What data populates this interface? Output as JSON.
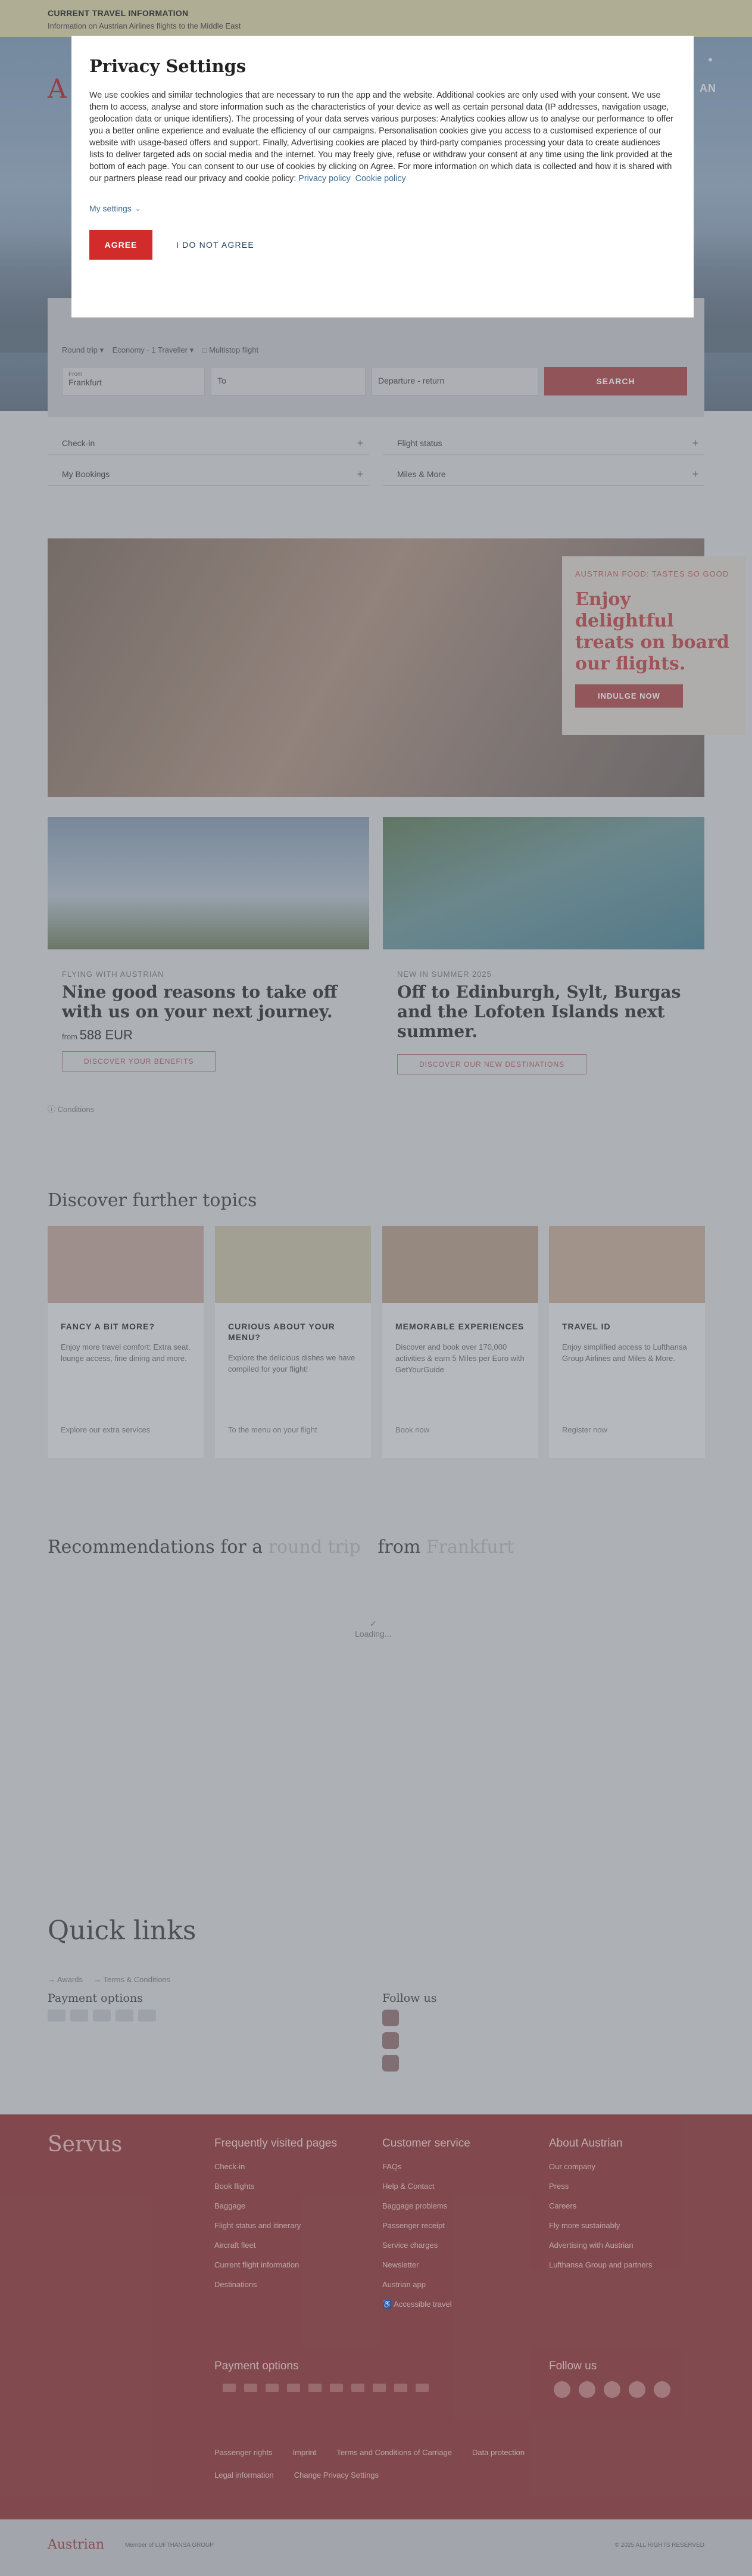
{
  "infobar": {
    "title": "CURRENT TRAVEL INFORMATION",
    "subtitle": "Information on Austrian Airlines flights to the Middle East"
  },
  "header": {
    "logo": "A",
    "nav_right": "AN"
  },
  "booking": {
    "trip": "Round trip",
    "cabin": "Economy · 1 Traveller",
    "flex": "Multistop flight",
    "from_label": "From",
    "from_value": "Frankfurt",
    "to": "To",
    "dates": "Departure - return",
    "search": "SEARCH"
  },
  "quicklinks_top": [
    {
      "label": "Check-in"
    },
    {
      "label": "Flight status"
    },
    {
      "label": "My Bookings"
    },
    {
      "label": "Miles & More"
    }
  ],
  "promo": {
    "kicker": "AUSTRIAN FOOD: TASTES SO GOOD",
    "title": "Enjoy delightful treats on board our flights.",
    "button": "INDULGE NOW"
  },
  "cards": [
    {
      "kicker": "FLYING WITH AUSTRIAN",
      "title": "Nine good reasons to take off with us on your next journey.",
      "price_from": "from",
      "price": "588 EUR",
      "button": "DISCOVER YOUR BENEFITS"
    },
    {
      "kicker": "NEW IN SUMMER 2025",
      "title": "Off to Edinburgh, Sylt, Burgas and the Lofoten Islands next summer.",
      "button": "DISCOVER OUR NEW DESTINATIONS"
    }
  ],
  "conditions": "Conditions",
  "topics": {
    "heading": "Discover further topics",
    "items": [
      {
        "title": "FANCY A BIT MORE?",
        "desc": "Enjoy more travel comfort: Extra seat, lounge access, fine dining and more.",
        "link": "Explore our extra services"
      },
      {
        "title": "CURIOUS ABOUT YOUR MENU?",
        "desc": "Explore the delicious dishes we have compiled for your flight!",
        "link": "To the menu on your flight"
      },
      {
        "title": "MEMORABLE EXPERIENCES",
        "desc": "Discover and book over 170,000 activities & earn 5 Miles per Euro with GetYourGuide",
        "link": "Book now"
      },
      {
        "title": "TRAVEL ID",
        "desc": "Enjoy simplified access to Lufthansa Group Airlines and Miles & More.",
        "link": "Register now"
      }
    ]
  },
  "reco": {
    "prefix": "Recommendations for a",
    "trip": "round trip",
    "from": "from",
    "city": "Frankfurt",
    "loading": "Loading..."
  },
  "quicklinks": {
    "heading": "Quick links",
    "links": [
      "Awards",
      "Terms & Conditions"
    ],
    "payment": "Payment options",
    "follow": "Follow us"
  },
  "footer": {
    "servus": "Servus",
    "col1": {
      "title": "Frequently visited pages",
      "items": [
        "Check-in",
        "Book flights",
        "Baggage",
        "Flight status and itinerary",
        "Aircraft fleet",
        "Current flight information",
        "Destinations"
      ]
    },
    "col2": {
      "title": "Customer service",
      "items": [
        "FAQs",
        "Help & Contact",
        "Baggage problems",
        "Passenger receipt",
        "Service charges",
        "Newsletter",
        "Austrian app",
        "Accessible travel"
      ]
    },
    "col3": {
      "title": "About Austrian",
      "items": [
        "Our company",
        "Press",
        "Careers",
        "Fly more sustainably",
        "Advertising with Austrian",
        "Lufthansa Group and partners"
      ]
    },
    "payment": "Payment options",
    "follow": "Follow us",
    "legal1": [
      "Passenger rights",
      "Imprint",
      "Terms and Conditions of Carriage",
      "Data protection"
    ],
    "legal2": [
      "Legal information",
      "Change Privacy Settings"
    ]
  },
  "bottom": {
    "logo": "Austrian",
    "member": "Member of LUFTHANSA GROUP",
    "copyright": "© 2025 ALL RIGHTS RESERVED"
  },
  "modal": {
    "title": "Privacy Settings",
    "body": "We use cookies and similar technologies that are necessary to run the app and the website. Additional cookies are only used with your consent. We use them to access, analyse and store information such as the characteristics of your device as well as certain personal data (IP addresses, navigation usage, geolocation data or unique identifiers). The processing of your data serves various purposes: Analytics cookies allow us to analyse our performance to offer you a better online experience and evaluate the efficiency of our campaigns. Personalisation cookies give you access to a customised experience of our website with usage-based offers and support. Finally, Advertising cookies are placed by third-party companies processing your data to create audiences lists to deliver targeted ads on social media and the internet. You may freely give, refuse or withdraw your consent at any time using the link provided at the bottom of each page. You can consent to our use of cookies by clicking on Agree. For more information on which data is collected and how it is shared with our partners please read our privacy and cookie policy:",
    "privacy_link": "Privacy policy",
    "cookie_link": "Cookie policy",
    "my_settings": "My settings",
    "agree": "AGREE",
    "disagree": "I DO NOT AGREE"
  }
}
